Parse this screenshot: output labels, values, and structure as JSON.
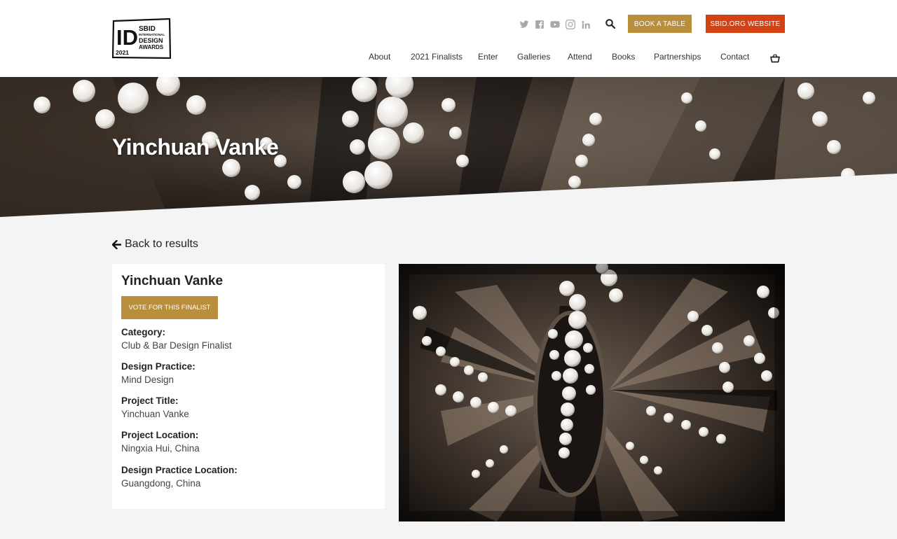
{
  "header": {
    "logo": {
      "letters": "ID",
      "line1": "SBID",
      "line2": "INTERNATIONAL",
      "line3": "DESIGN",
      "line4": "AWARDS",
      "year": "2021"
    },
    "social_icons": [
      "twitter-icon",
      "facebook-icon",
      "youtube-icon",
      "instagram-icon",
      "linkedin-icon"
    ],
    "book_label": "BOOK A TABLE",
    "sbid_label": "SBID.ORG WEBSITE",
    "nav": [
      "About",
      "2021 Finalists",
      "Enter",
      "Galleries",
      "Attend",
      "Books",
      "Partnerships",
      "Contact"
    ]
  },
  "hero": {
    "title": "Yinchuan Vanke"
  },
  "back_label": "Back to results",
  "card": {
    "title": "Yinchuan Vanke",
    "vote_label": "VOTE FOR THIS FINALIST",
    "fields": [
      {
        "label": "Category:",
        "value": "Club & Bar Design Finalist"
      },
      {
        "label": "Design Practice:",
        "value": "Mind Design"
      },
      {
        "label": "Project Title:",
        "value": "Yinchuan Vanke"
      },
      {
        "label": "Project Location:",
        "value": "Ningxia Hui, China"
      },
      {
        "label": "Design Practice Location:",
        "value": "Guangdong, China"
      }
    ]
  },
  "colors": {
    "gold": "#b98e3c",
    "orange_red": "#d44214",
    "page_bg": "#f4f4f4"
  }
}
